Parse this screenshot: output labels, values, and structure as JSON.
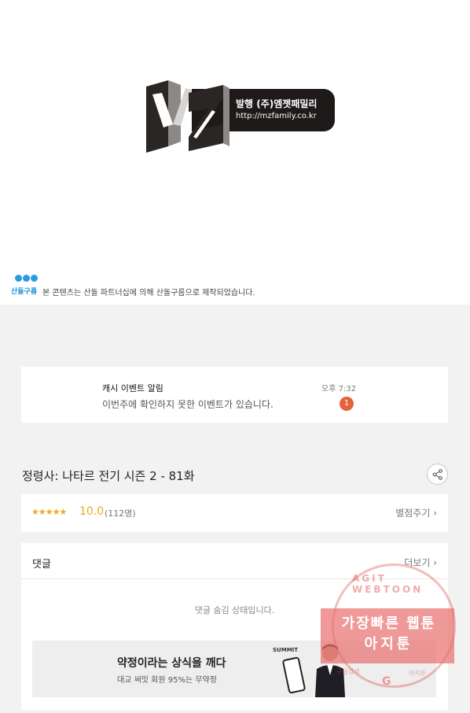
{
  "publisher": {
    "logo_text": "MZ",
    "line1": "발행 (주)엠젯패밀리",
    "line2": "http://mzfamily.co.kr"
  },
  "studio": {
    "brand": "산돌구름",
    "notice": "본 콘텐츠는 산돌 파트너십에 의해 산돌구름으로 제작되었습니다."
  },
  "notification": {
    "title": "캐시 이벤트 알림",
    "message": "이번주에 확인하지 못한 이벤트가 있습니다.",
    "time": "오후 7:32",
    "badge": "1"
  },
  "episode": {
    "title": "정령사: 나타르 전기 시즌 2 - 81화",
    "share_icon": "share-icon"
  },
  "rating": {
    "stars": "★★★★★",
    "score": "10.0",
    "count": "(112명)",
    "rate_button": "별점주기 ›",
    "star_color": "#f0a81e"
  },
  "comments": {
    "label": "댓글",
    "more_button": "더보기 ›",
    "hidden_text": "댓글 숨김 상태입니다."
  },
  "ad": {
    "headline": "약정이라는 상식을 깨다",
    "subline": "대교 써밋 회원 95%는 무약정",
    "brand": "SUMMIT"
  },
  "watermark": {
    "line1": "가장빠른 웹툰",
    "line2": "아지툰",
    "arc_text": "AGIT WEBTOON",
    "bottom_left": "구글검색",
    "bottom_right": "아지툰",
    "g": "G"
  }
}
